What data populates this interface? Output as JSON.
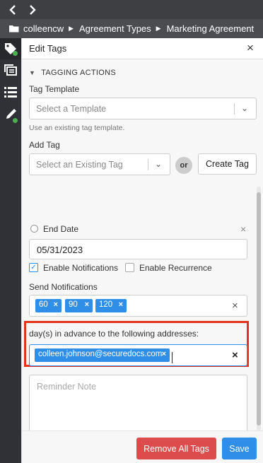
{
  "topbar": {
    "back_icon": "chevron-left-icon",
    "forward_icon": "chevron-right-icon"
  },
  "breadcrumb": {
    "folder_icon": "folder-open-icon",
    "items": [
      "colleencw",
      "Agreement Types",
      "Marketing Agreement"
    ],
    "separator": "▶"
  },
  "rail": {
    "items": [
      "tags-icon",
      "documents-stack-icon",
      "list-icon",
      "pen-icon"
    ],
    "active": "tags-icon",
    "status_color": "#4caf50"
  },
  "panel": {
    "title": "Edit Tags",
    "close_label": "×",
    "tagging_actions": {
      "heading": "TAGGING ACTIONS",
      "tag_template_label": "Tag Template",
      "tag_template_placeholder": "Select a Template",
      "tag_template_hint": "Use an existing tag template.",
      "add_tag_label": "Add Tag",
      "add_tag_placeholder": "Select an Existing Tag",
      "or_label": "or",
      "create_tag_label": "Create Tag"
    },
    "form": {
      "end_date_label": "End Date",
      "end_date_value": "05/31/2023",
      "remove_x": "×",
      "enable_notifications_label": "Enable Notifications",
      "enable_notifications_checked": true,
      "enable_recurrence_label": "Enable Recurrence",
      "enable_recurrence_checked": false,
      "send_notifications_label": "Send Notifications",
      "days": [
        "60",
        "90",
        "120"
      ],
      "chip_remove": "×",
      "clear_x": "×",
      "advance_label": "day(s) in advance to the following addresses:",
      "emails": [
        "colleen.johnson@securedocs.com"
      ],
      "reminder_placeholder": "Reminder Note"
    },
    "footer": {
      "remove_all_label": "Remove All Tags",
      "save_label": "Save"
    }
  },
  "colors": {
    "primary": "#2f8ee8",
    "danger": "#dc4c4c",
    "highlight": "#e2341d"
  }
}
